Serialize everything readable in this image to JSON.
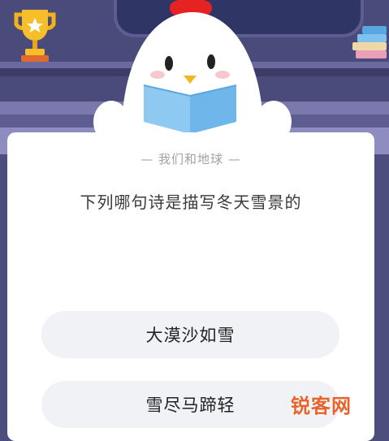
{
  "quiz": {
    "subject": "— 我们和地球 —",
    "question": "下列哪句诗是描写冬天雪景的",
    "options": [
      {
        "label": "大漠沙如雪"
      },
      {
        "label": "雪尽马蹄轻"
      }
    ]
  },
  "watermark": {
    "text": "锐客网"
  },
  "colors": {
    "background": "#4b4b7b",
    "card": "#ffffff",
    "option_bg": "#f1f2f6",
    "watermark": "#e8632b"
  },
  "icons": [
    "trophy-icon",
    "books-icon",
    "chick-mascot"
  ]
}
